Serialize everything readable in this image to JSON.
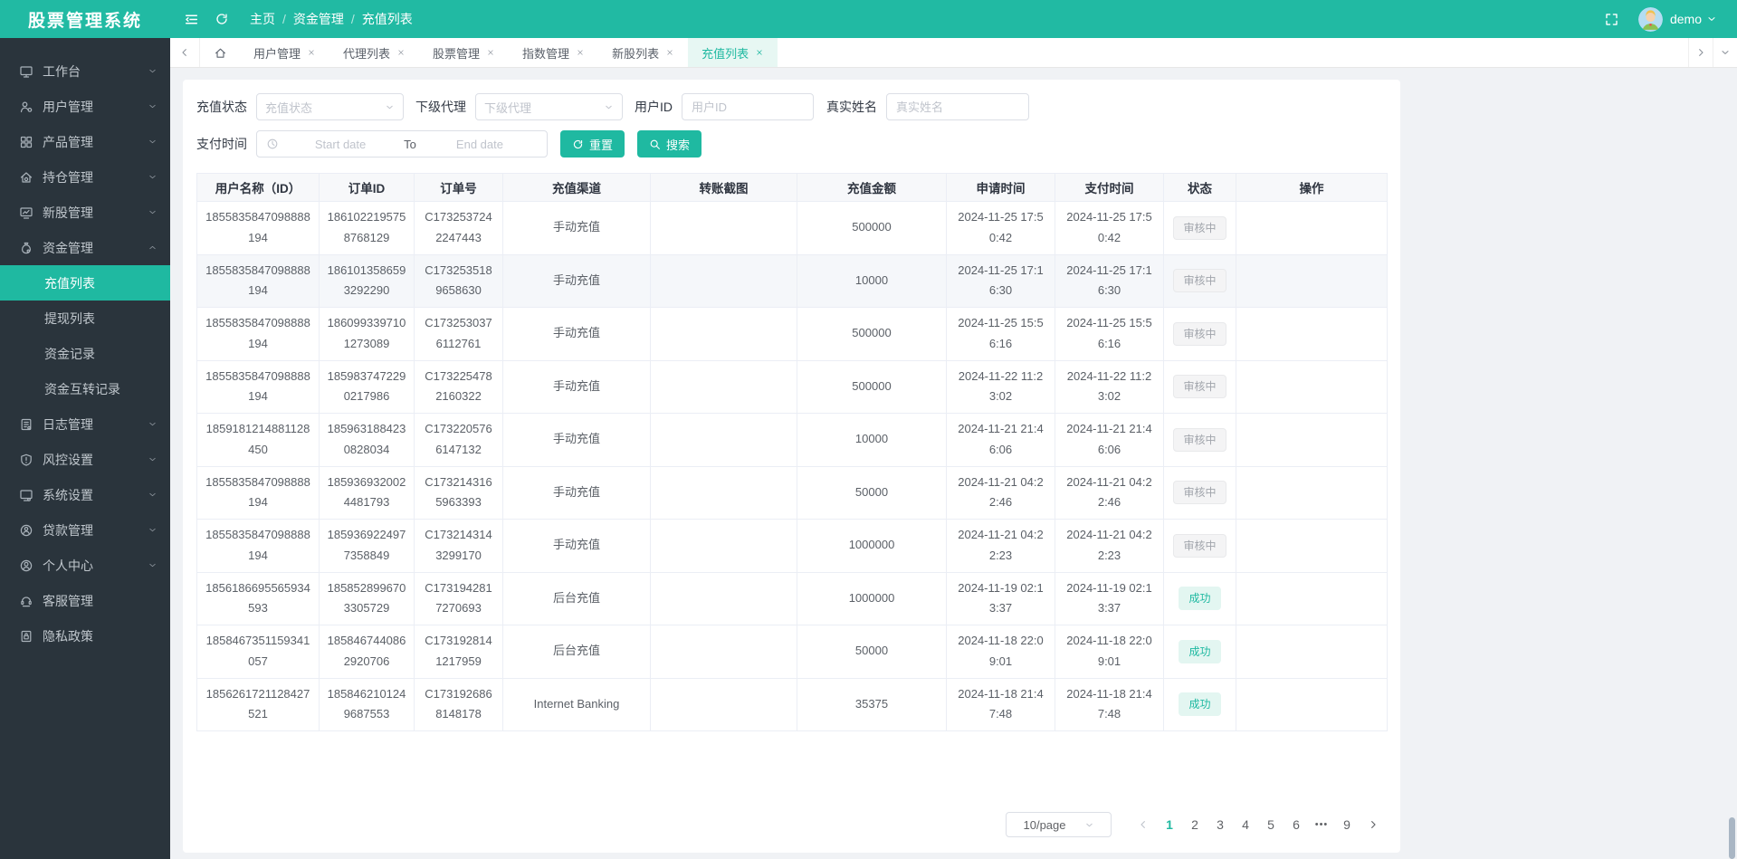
{
  "header": {
    "title": "股票管理系统",
    "breadcrumb": [
      "主页",
      "资金管理",
      "充值列表"
    ],
    "username": "demo"
  },
  "sidebar": {
    "items": [
      {
        "key": "workbench",
        "label": "工作台",
        "chevron": "down"
      },
      {
        "key": "users",
        "label": "用户管理",
        "chevron": "down"
      },
      {
        "key": "products",
        "label": "产品管理",
        "chevron": "down"
      },
      {
        "key": "positions",
        "label": "持仓管理",
        "chevron": "down"
      },
      {
        "key": "new-stocks",
        "label": "新股管理",
        "chevron": "down"
      },
      {
        "key": "funds",
        "label": "资金管理",
        "chevron": "up",
        "children": [
          {
            "key": "recharge-list",
            "label": "充值列表",
            "active": true
          },
          {
            "key": "withdraw-list",
            "label": "提现列表"
          },
          {
            "key": "fund-records",
            "label": "资金记录"
          },
          {
            "key": "fund-transfer-records",
            "label": "资金互转记录"
          }
        ]
      },
      {
        "key": "logs",
        "label": "日志管理",
        "chevron": "down"
      },
      {
        "key": "risk",
        "label": "风控设置",
        "chevron": "down"
      },
      {
        "key": "system",
        "label": "系统设置",
        "chevron": "down"
      },
      {
        "key": "loans",
        "label": "贷款管理",
        "chevron": "down"
      },
      {
        "key": "profile",
        "label": "个人中心",
        "chevron": "down"
      },
      {
        "key": "service",
        "label": "客服管理",
        "chevron": "none"
      },
      {
        "key": "privacy",
        "label": "隐私政策",
        "chevron": "none"
      }
    ]
  },
  "tabs": [
    {
      "key": "users",
      "label": "用户管理"
    },
    {
      "key": "agents",
      "label": "代理列表"
    },
    {
      "key": "stocks",
      "label": "股票管理"
    },
    {
      "key": "indexes",
      "label": "指数管理"
    },
    {
      "key": "new-stocks",
      "label": "新股列表"
    },
    {
      "key": "recharge-list",
      "label": "充值列表",
      "active": true
    }
  ],
  "filters": {
    "status": {
      "label": "充值状态",
      "placeholder": "充值状态"
    },
    "agent": {
      "label": "下级代理",
      "placeholder": "下级代理"
    },
    "user_id": {
      "label": "用户ID",
      "placeholder": "用户ID"
    },
    "real_name": {
      "label": "真实姓名",
      "placeholder": "真实姓名"
    },
    "pay_time": {
      "label": "支付时间",
      "start_placeholder": "Start date",
      "separator": "To",
      "end_placeholder": "End date"
    },
    "reset_label": "重置",
    "search_label": "搜索"
  },
  "table": {
    "columns": [
      "用户名称（ID）",
      "订单ID",
      "订单号",
      "充值渠道",
      "转账截图",
      "充值金额",
      "申请时间",
      "支付时间",
      "状态",
      "操作"
    ],
    "rows": [
      {
        "user_id": "1855835847098888194",
        "order_id": "1861022195758768129",
        "order_no": "C1732537242247443",
        "channel": "手动充值",
        "screenshot": "",
        "amount": "500000",
        "apply_time": "2024-11-25 17:50:42",
        "pay_time": "2024-11-25 17:50:42",
        "status": "审核中",
        "status_type": "pending"
      },
      {
        "user_id": "1855835847098888194",
        "order_id": "1861013586593292290",
        "order_no": "C1732535189658630",
        "channel": "手动充值",
        "screenshot": "",
        "amount": "10000",
        "apply_time": "2024-11-25 17:16:30",
        "pay_time": "2024-11-25 17:16:30",
        "status": "审核中",
        "status_type": "pending"
      },
      {
        "user_id": "1855835847098888194",
        "order_id": "1860993397101273089",
        "order_no": "C1732530376112761",
        "channel": "手动充值",
        "screenshot": "",
        "amount": "500000",
        "apply_time": "2024-11-25 15:56:16",
        "pay_time": "2024-11-25 15:56:16",
        "status": "审核中",
        "status_type": "pending"
      },
      {
        "user_id": "1855835847098888194",
        "order_id": "1859837472290217986",
        "order_no": "C1732254782160322",
        "channel": "手动充值",
        "screenshot": "",
        "amount": "500000",
        "apply_time": "2024-11-22 11:23:02",
        "pay_time": "2024-11-22 11:23:02",
        "status": "审核中",
        "status_type": "pending"
      },
      {
        "user_id": "1859181214881128450",
        "order_id": "1859631884230828034",
        "order_no": "C1732205766147132",
        "channel": "手动充值",
        "screenshot": "",
        "amount": "10000",
        "apply_time": "2024-11-21 21:46:06",
        "pay_time": "2024-11-21 21:46:06",
        "status": "审核中",
        "status_type": "pending"
      },
      {
        "user_id": "1855835847098888194",
        "order_id": "1859369320024481793",
        "order_no": "C1732143165963393",
        "channel": "手动充值",
        "screenshot": "",
        "amount": "50000",
        "apply_time": "2024-11-21 04:22:46",
        "pay_time": "2024-11-21 04:22:46",
        "status": "审核中",
        "status_type": "pending"
      },
      {
        "user_id": "1855835847098888194",
        "order_id": "1859369224977358849",
        "order_no": "C1732143143299170",
        "channel": "手动充值",
        "screenshot": "",
        "amount": "1000000",
        "apply_time": "2024-11-21 04:22:23",
        "pay_time": "2024-11-21 04:22:23",
        "status": "审核中",
        "status_type": "pending"
      },
      {
        "user_id": "1856186695565934593",
        "order_id": "1858528996703305729",
        "order_no": "C1731942817270693",
        "channel": "后台充值",
        "screenshot": "",
        "amount": "1000000",
        "apply_time": "2024-11-19 02:13:37",
        "pay_time": "2024-11-19 02:13:37",
        "status": "成功",
        "status_type": "success"
      },
      {
        "user_id": "1858467351159341057",
        "order_id": "1858467440862920706",
        "order_no": "C1731928141217959",
        "channel": "后台充值",
        "screenshot": "",
        "amount": "50000",
        "apply_time": "2024-11-18 22:09:01",
        "pay_time": "2024-11-18 22:09:01",
        "status": "成功",
        "status_type": "success"
      },
      {
        "user_id": "1856261721128427521",
        "order_id": "1858462101249687553",
        "order_no": "C1731926868148178",
        "channel": "Internet Banking",
        "screenshot": "",
        "amount": "35375",
        "apply_time": "2024-11-18 21:47:48",
        "pay_time": "2024-11-18 21:47:48",
        "status": "成功",
        "status_type": "success"
      }
    ]
  },
  "pagination": {
    "page_size": "10/page",
    "pages": [
      "1",
      "2",
      "3",
      "4",
      "5",
      "6",
      "•••",
      "9"
    ],
    "active_page": "1"
  },
  "colors": {
    "primary": "#1fb9a1",
    "header_bg": "#21baa3",
    "sidebar_bg": "#2a343c",
    "success_text": "#1fb9a1",
    "pending_text": "#a1a5ac"
  }
}
